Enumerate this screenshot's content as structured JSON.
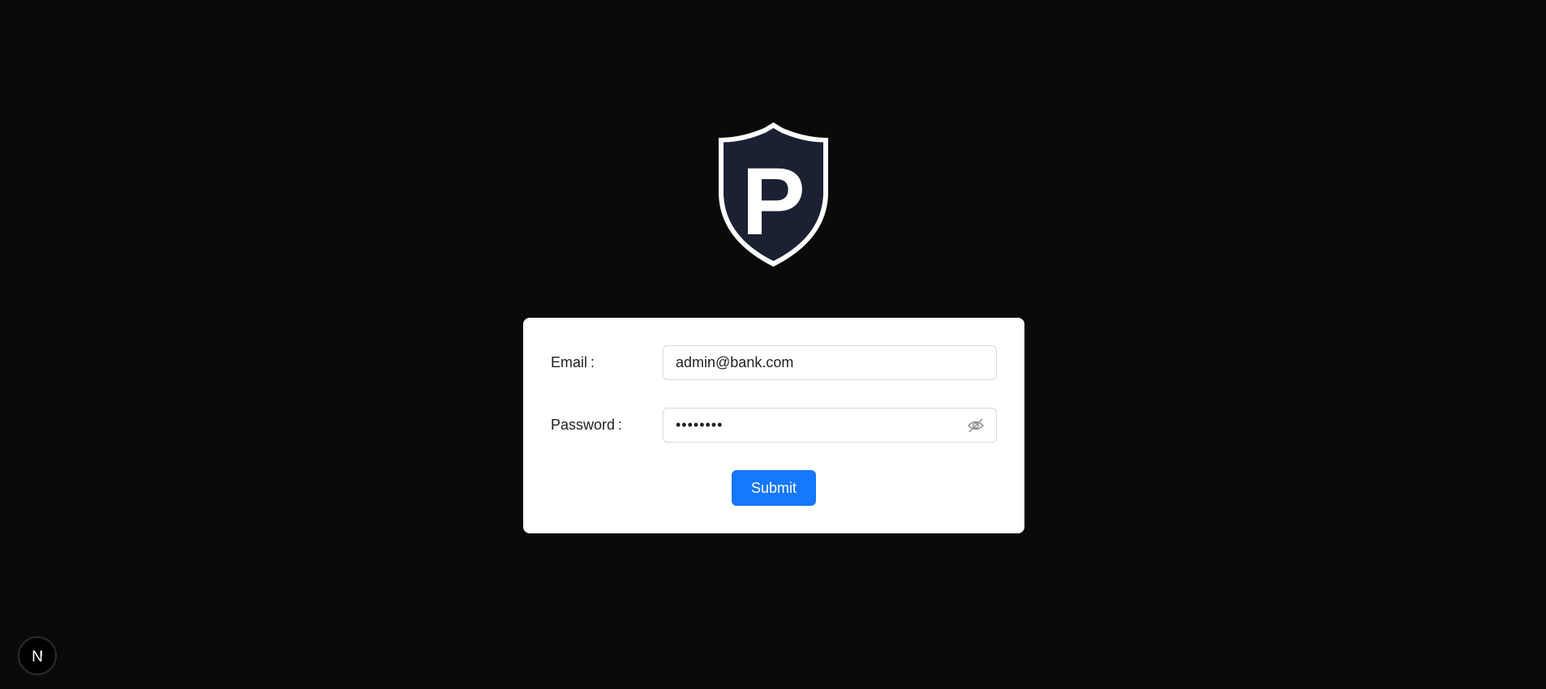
{
  "logo": {
    "letter": "P",
    "shield_fill": "#1c2033",
    "shield_outline": "#ffffff"
  },
  "form": {
    "email_label": "Email",
    "password_label": "Password",
    "colon": ":",
    "email_value": "admin@bank.com",
    "password_value": "password",
    "password_toggle_icon": "eye-invisible-icon",
    "submit_label": "Submit"
  },
  "dev_badge": {
    "icon": "nextjs-icon",
    "letter": "N"
  },
  "colors": {
    "background": "#0a0a0a",
    "card": "#ffffff",
    "primary": "#1677ff"
  }
}
